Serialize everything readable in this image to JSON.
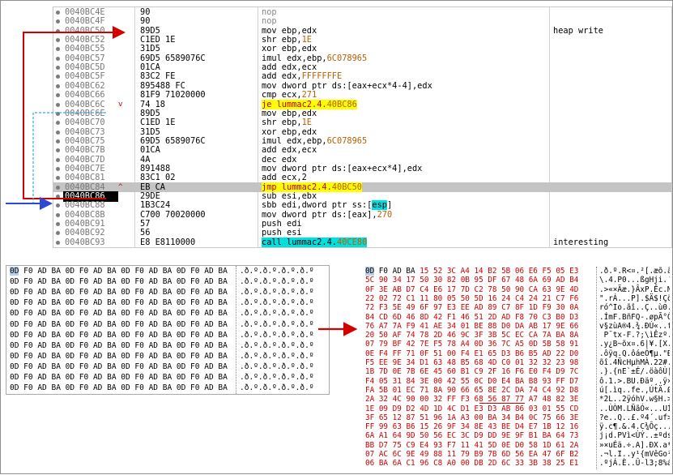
{
  "disasm": {
    "rows": [
      {
        "addr": "0040BC4E",
        "mark": "",
        "bytes": "90",
        "instr": "nop",
        "cmt": "",
        "kind": "nop"
      },
      {
        "addr": "0040BC4F",
        "mark": "",
        "bytes": "90",
        "instr": "nop",
        "cmt": "",
        "kind": "nop"
      },
      {
        "addr": "0040BC50",
        "mark": "",
        "bytes": "89D5",
        "instr": "mov ebp,edx",
        "cmt": "heap write",
        "kind": "plain"
      },
      {
        "addr": "0040BC52",
        "mark": "",
        "bytes": "C1ED 1E",
        "instr": "shr ebp,1E",
        "cmt": "",
        "kind": "plain"
      },
      {
        "addr": "0040BC55",
        "mark": "",
        "bytes": "31D5",
        "instr": "xor ebp,edx",
        "cmt": "",
        "kind": "plain"
      },
      {
        "addr": "0040BC57",
        "mark": "",
        "bytes": "69D5 6589076C",
        "instr": "imul edx,ebp,6C078965",
        "cmt": "",
        "kind": "plain"
      },
      {
        "addr": "0040BC5D",
        "mark": "",
        "bytes": "01CA",
        "instr": "add edx,ecx",
        "cmt": "",
        "kind": "plain"
      },
      {
        "addr": "0040BC5F",
        "mark": "",
        "bytes": "83C2 FE",
        "instr": "add edx,FFFFFFFE",
        "cmt": "",
        "kind": "plain"
      },
      {
        "addr": "0040BC62",
        "mark": "",
        "bytes": "895488 FC",
        "instr": "mov dword ptr ds:[eax+ecx*4-4],edx",
        "cmt": "",
        "kind": "plain"
      },
      {
        "addr": "0040BC66",
        "mark": "",
        "bytes": "81F9 71020000",
        "instr": "cmp ecx,271",
        "cmt": "",
        "kind": "plain"
      },
      {
        "addr": "0040BC6C",
        "mark": "v",
        "bytes": "74 18",
        "instr": "je lummac2.4.40BC86",
        "cmt": "",
        "kind": "jump"
      },
      {
        "addr": "0040BC6E",
        "mark": "",
        "bytes": "89D5",
        "instr": "mov ebp,edx",
        "cmt": "",
        "kind": "plain"
      },
      {
        "addr": "0040BC70",
        "mark": "",
        "bytes": "C1ED 1E",
        "instr": "shr ebp,1E",
        "cmt": "",
        "kind": "plain"
      },
      {
        "addr": "0040BC73",
        "mark": "",
        "bytes": "31D5",
        "instr": "xor ebp,edx",
        "cmt": "",
        "kind": "plain"
      },
      {
        "addr": "0040BC75",
        "mark": "",
        "bytes": "69D5 6589076C",
        "instr": "imul edx,ebp,6C078965",
        "cmt": "",
        "kind": "plain"
      },
      {
        "addr": "0040BC7B",
        "mark": "",
        "bytes": "01CA",
        "instr": "add edx,ecx",
        "cmt": "",
        "kind": "plain"
      },
      {
        "addr": "0040BC7D",
        "mark": "",
        "bytes": "4A",
        "instr": "dec edx",
        "cmt": "",
        "kind": "plain"
      },
      {
        "addr": "0040BC7E",
        "mark": "",
        "bytes": "891488",
        "instr": "mov dword ptr ds:[eax+ecx*4],edx",
        "cmt": "",
        "kind": "plain"
      },
      {
        "addr": "0040BC81",
        "mark": "",
        "bytes": "83C1 02",
        "instr": "add ecx,2",
        "cmt": "",
        "kind": "plain"
      },
      {
        "addr": "0040BC84",
        "mark": "^",
        "bytes": "EB CA",
        "instr": "jmp lummac2.4.40BC50",
        "cmt": "",
        "kind": "jump",
        "highlight": true
      },
      {
        "addr": "0040BC86",
        "mark": "",
        "bytes": "29DE",
        "instr": "sub esi,ebx",
        "cmt": "",
        "kind": "plain",
        "current": true
      },
      {
        "addr": "0040BC88",
        "mark": "",
        "bytes": "1B3C24",
        "instr": "sbb edi,dword ptr ss:[esp]",
        "cmt": "",
        "kind": "plain"
      },
      {
        "addr": "0040BC8B",
        "mark": "",
        "bytes": "C700 70020000",
        "instr": "mov dword ptr ds:[eax],270",
        "cmt": "",
        "kind": "plain"
      },
      {
        "addr": "0040BC91",
        "mark": "",
        "bytes": "57",
        "instr": "push edi",
        "cmt": "",
        "kind": "plain"
      },
      {
        "addr": "0040BC92",
        "mark": "",
        "bytes": "56",
        "instr": "push esi",
        "cmt": "",
        "kind": "plain"
      },
      {
        "addr": "0040BC93",
        "mark": "",
        "bytes": "E8 E8110000",
        "instr": "call lummac2.4.40CE80",
        "cmt": "interesting",
        "kind": "call"
      }
    ]
  },
  "dumpA": {
    "rows": [
      {
        "hex": "0D F0 AD BA 0D F0 AD BA 0D F0 AD BA 0D F0 AD BA",
        "ascii": ".ð.º.ð.º.ð.º.ð.º"
      },
      {
        "hex": "0D F0 AD BA 0D F0 AD BA 0D F0 AD BA 0D F0 AD BA",
        "ascii": ".ð.º.ð.º.ð.º.ð.º"
      },
      {
        "hex": "0D F0 AD BA 0D F0 AD BA 0D F0 AD BA 0D F0 AD BA",
        "ascii": ".ð.º.ð.º.ð.º.ð.º"
      },
      {
        "hex": "0D F0 AD BA 0D F0 AD BA 0D F0 AD BA 0D F0 AD BA",
        "ascii": ".ð.º.ð.º.ð.º.ð.º"
      },
      {
        "hex": "0D F0 AD BA 0D F0 AD BA 0D F0 AD BA 0D F0 AD BA",
        "ascii": ".ð.º.ð.º.ð.º.ð.º"
      },
      {
        "hex": "0D F0 AD BA 0D F0 AD BA 0D F0 AD BA 0D F0 AD BA",
        "ascii": ".ð.º.ð.º.ð.º.ð.º"
      },
      {
        "hex": "0D F0 AD BA 0D F0 AD BA 0D F0 AD BA 0D F0 AD BA",
        "ascii": ".ð.º.ð.º.ð.º.ð.º"
      },
      {
        "hex": "0D F0 AD BA 0D F0 AD BA 0D F0 AD BA 0D F0 AD BA",
        "ascii": ".ð.º.ð.º.ð.º.ð.º"
      },
      {
        "hex": "0D F0 AD BA 0D F0 AD BA 0D F0 AD BA 0D F0 AD BA",
        "ascii": ".ð.º.ð.º.ð.º.ð.º"
      },
      {
        "hex": "0D F0 AD BA 0D F0 AD BA 0D F0 AD BA 0D F0 AD BA",
        "ascii": ".ð.º.ð.º.ð.º.ð.º"
      },
      {
        "hex": "0D F0 AD BA 0D F0 AD BA 0D F0 AD BA 0D F0 AD BA",
        "ascii": ".ð.º.ð.º.ð.º.ð.º"
      },
      {
        "hex": "0D F0 AD BA 0D F0 AD BA 0D F0 AD BA 0D F0 AD BA",
        "ascii": ".ð.º.ð.º.ð.º.ð.º"
      }
    ]
  },
  "dumpB": {
    "rows": [
      {
        "hex": "0D F0 AD BA 15 52 3C A4 14 B2 5B 06 E6 F5 05 E3",
        "ascii": ".ð.º.R<¤.²[.æõ.ã"
      },
      {
        "hex": "5C 90 34 17 50 30 82 0B 95 DF 67 48 6A 69 AD B4",
        "ascii": "\\.4.P0...ßgHji.´"
      },
      {
        "hex": "0F 3E AB D7 C4 E6 17 7D C2 78 50 90 CA 63 9E 4D",
        "ascii": ".>«×Äæ.}ÂxP.Êc.M"
      },
      {
        "hex": "22 02 72 C1 11 80 05 50 5D 16 24 C4 24 21 C7 F6",
        "ascii": "\".rÁ...P].$Ä$!Çö"
      },
      {
        "hex": "72 F3 5E 49 6F 97 E3 EE AD 89 C7 8F 1D F9 30 0A",
        "ascii": "ró^Io.ãî..Ç..ù0."
      },
      {
        "hex": "84 CD 6D 46 8D 42 F1 46 51 2D AD F8 70 C3 B0 D3",
        "ascii": ".ÍmF.BñFQ-.øpÃ°Ó"
      },
      {
        "hex": "76 A7 7A F9 41 AE 34 01 BE 88 D0 DA AB 17 9E 66",
        "ascii": "v§zùA®4.¾.ÐÚ«..f"
      },
      {
        "hex": "20 50 AF 74 78 2D 46 9C 3F 3B 5C EC CA 7A BA 8A",
        "ascii": " P¯tx-F.?;\\ìÊzº."
      },
      {
        "hex": "07 79 BF 42 7E F5 78 A4 0D 36 7C A5 0D 5B 58 91",
        "ascii": ".y¿B~õx¤.6|¥.[X."
      },
      {
        "hex": "0E F4 FF 71 0F 51 00 F4 E1 65 D3 B6 B5 AD 22 D0",
        "ascii": ".ôÿq.Q.ôáeÓ¶µ.\"Ð"
      },
      {
        "hex": "F5 EE 9E 34 D1 63 48 B5 68 4D C0 01 32 32 23 98",
        "ascii": "õî.4ÑcHµhMÀ.22#."
      },
      {
        "hex": "1B 7D 0E 7B 6E 45 60 B1 C9 2F 16 F6 E0 F4 D9 7C",
        "ascii": ".}.{nE`±É/.öàôÙ|"
      },
      {
        "hex": "F4 05 31 84 3E 00 42 55 0C D0 E4 BA B8 93 FF D7",
        "ascii": "ô.1.>.BU.Ðäº¸.ÿ×"
      },
      {
        "hex": "FA 5B 01 EC 71 8A 90 66 65 8E 2C DA 74 C4 92 D8",
        "ascii": "ú[.ìq..fe.,ÚtÄ.Ø"
      },
      {
        "hex": "2A 32 4C 90 00 32 FF F3 68 56 87 77 A7 48 82 3E",
        "ascii": "*2L..2ÿóhV.w§H.>"
      },
      {
        "hex": "1E 09 D9 D2 4D 1D 4C D1 E3 D3 AB 86 03 01 55 CD",
        "ascii": "..ÙÒM.LÑãÓ«...UÍ"
      },
      {
        "hex": "3F 65 12 87 51 96 1A A3 00 BA 34 B4 0C 75 66 3E",
        "ascii": "?e..Q..£.º4´.uf>"
      },
      {
        "hex": "FF 99 63 B6 15 26 9F 34 8E 43 BE D4 E7 1B 12 16",
        "ascii": "ÿ.c¶.&.4.C¾Ôç..."
      },
      {
        "hex": "6A A1 64 9D 50 56 EC 3C D9 DD 9E 9F B1 BA 64 73",
        "ascii": "j¡d.PVì<ÙÝ..±ºds"
      },
      {
        "hex": "BB D7 75 C9 E4 93 F7 11 41 5D 0E D0 58 1D 61 2A",
        "ascii": "»×uÉä.÷.A].ÐX.a*"
      },
      {
        "hex": "07 AC 6C 9E 49 88 11 79 B9 7B 6D 56 EA 47 6F B2",
        "ascii": ".¬l.I..y¹{mVêGo²"
      },
      {
        "hex": "06 BA 6A C1 96 C8 A0 00 DB 2D 6C 33 3B 38 25 E1",
        "ascii": ".ºjÁ.È..Û-l3;8%á"
      }
    ]
  }
}
